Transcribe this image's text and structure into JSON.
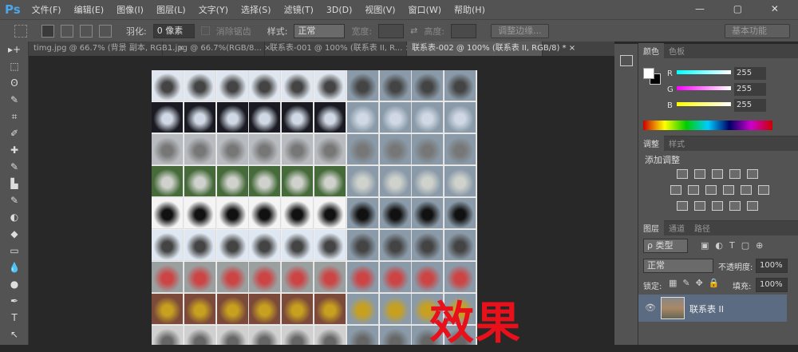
{
  "app": {
    "logo": "Ps"
  },
  "menu": [
    "文件(F)",
    "编辑(E)",
    "图像(I)",
    "图层(L)",
    "文字(Y)",
    "选择(S)",
    "滤镜(T)",
    "3D(D)",
    "视图(V)",
    "窗口(W)",
    "帮助(H)"
  ],
  "window_controls": "— ▢ ✕",
  "options": {
    "feather_label": "羽化:",
    "feather_value": "0 像素",
    "antialias_label": "消除锯齿",
    "style_label": "样式:",
    "style_value": "正常",
    "width_label": "宽度:",
    "height_label": "高度:",
    "refine_edge": "调整边缘...",
    "workspace": "基本功能"
  },
  "tabs": [
    {
      "label": "timg.jpg @ 66.7% (背景 副本, RGB..."
    },
    {
      "label": "1.jpg @ 66.7%(RGB/8..."
    },
    {
      "label": "联系表-001 @ 100% (联系表 II, R..."
    },
    {
      "label": "联系表-002 @ 100% (联系表 II, RGB/8) *"
    }
  ],
  "tools": [
    "▸+",
    "⬚",
    "ʘ",
    "✎",
    "⌗",
    "✐",
    "✚",
    "✎",
    "▙",
    "✎",
    "◐",
    "◆",
    "▭",
    "💧",
    "●",
    "✒",
    "T",
    "↖"
  ],
  "canvas": {
    "overlay_text": "效果"
  },
  "color_panel": {
    "tabs": [
      "颜色",
      "色板"
    ],
    "r_label": "R",
    "g_label": "G",
    "b_label": "B",
    "r": "255",
    "g": "255",
    "b": "255"
  },
  "adjust_panel": {
    "tabs": [
      "调整",
      "样式"
    ],
    "title": "添加调整"
  },
  "layers_panel": {
    "tabs": [
      "图层",
      "通道",
      "路径"
    ],
    "filter": "ρ 类型",
    "blend": "正常",
    "opacity_label": "不透明度:",
    "opacity": "100%",
    "lock_label": "锁定:",
    "fill_label": "填充:",
    "fill": "100%",
    "layers": [
      {
        "name": "联系表 II"
      }
    ]
  }
}
